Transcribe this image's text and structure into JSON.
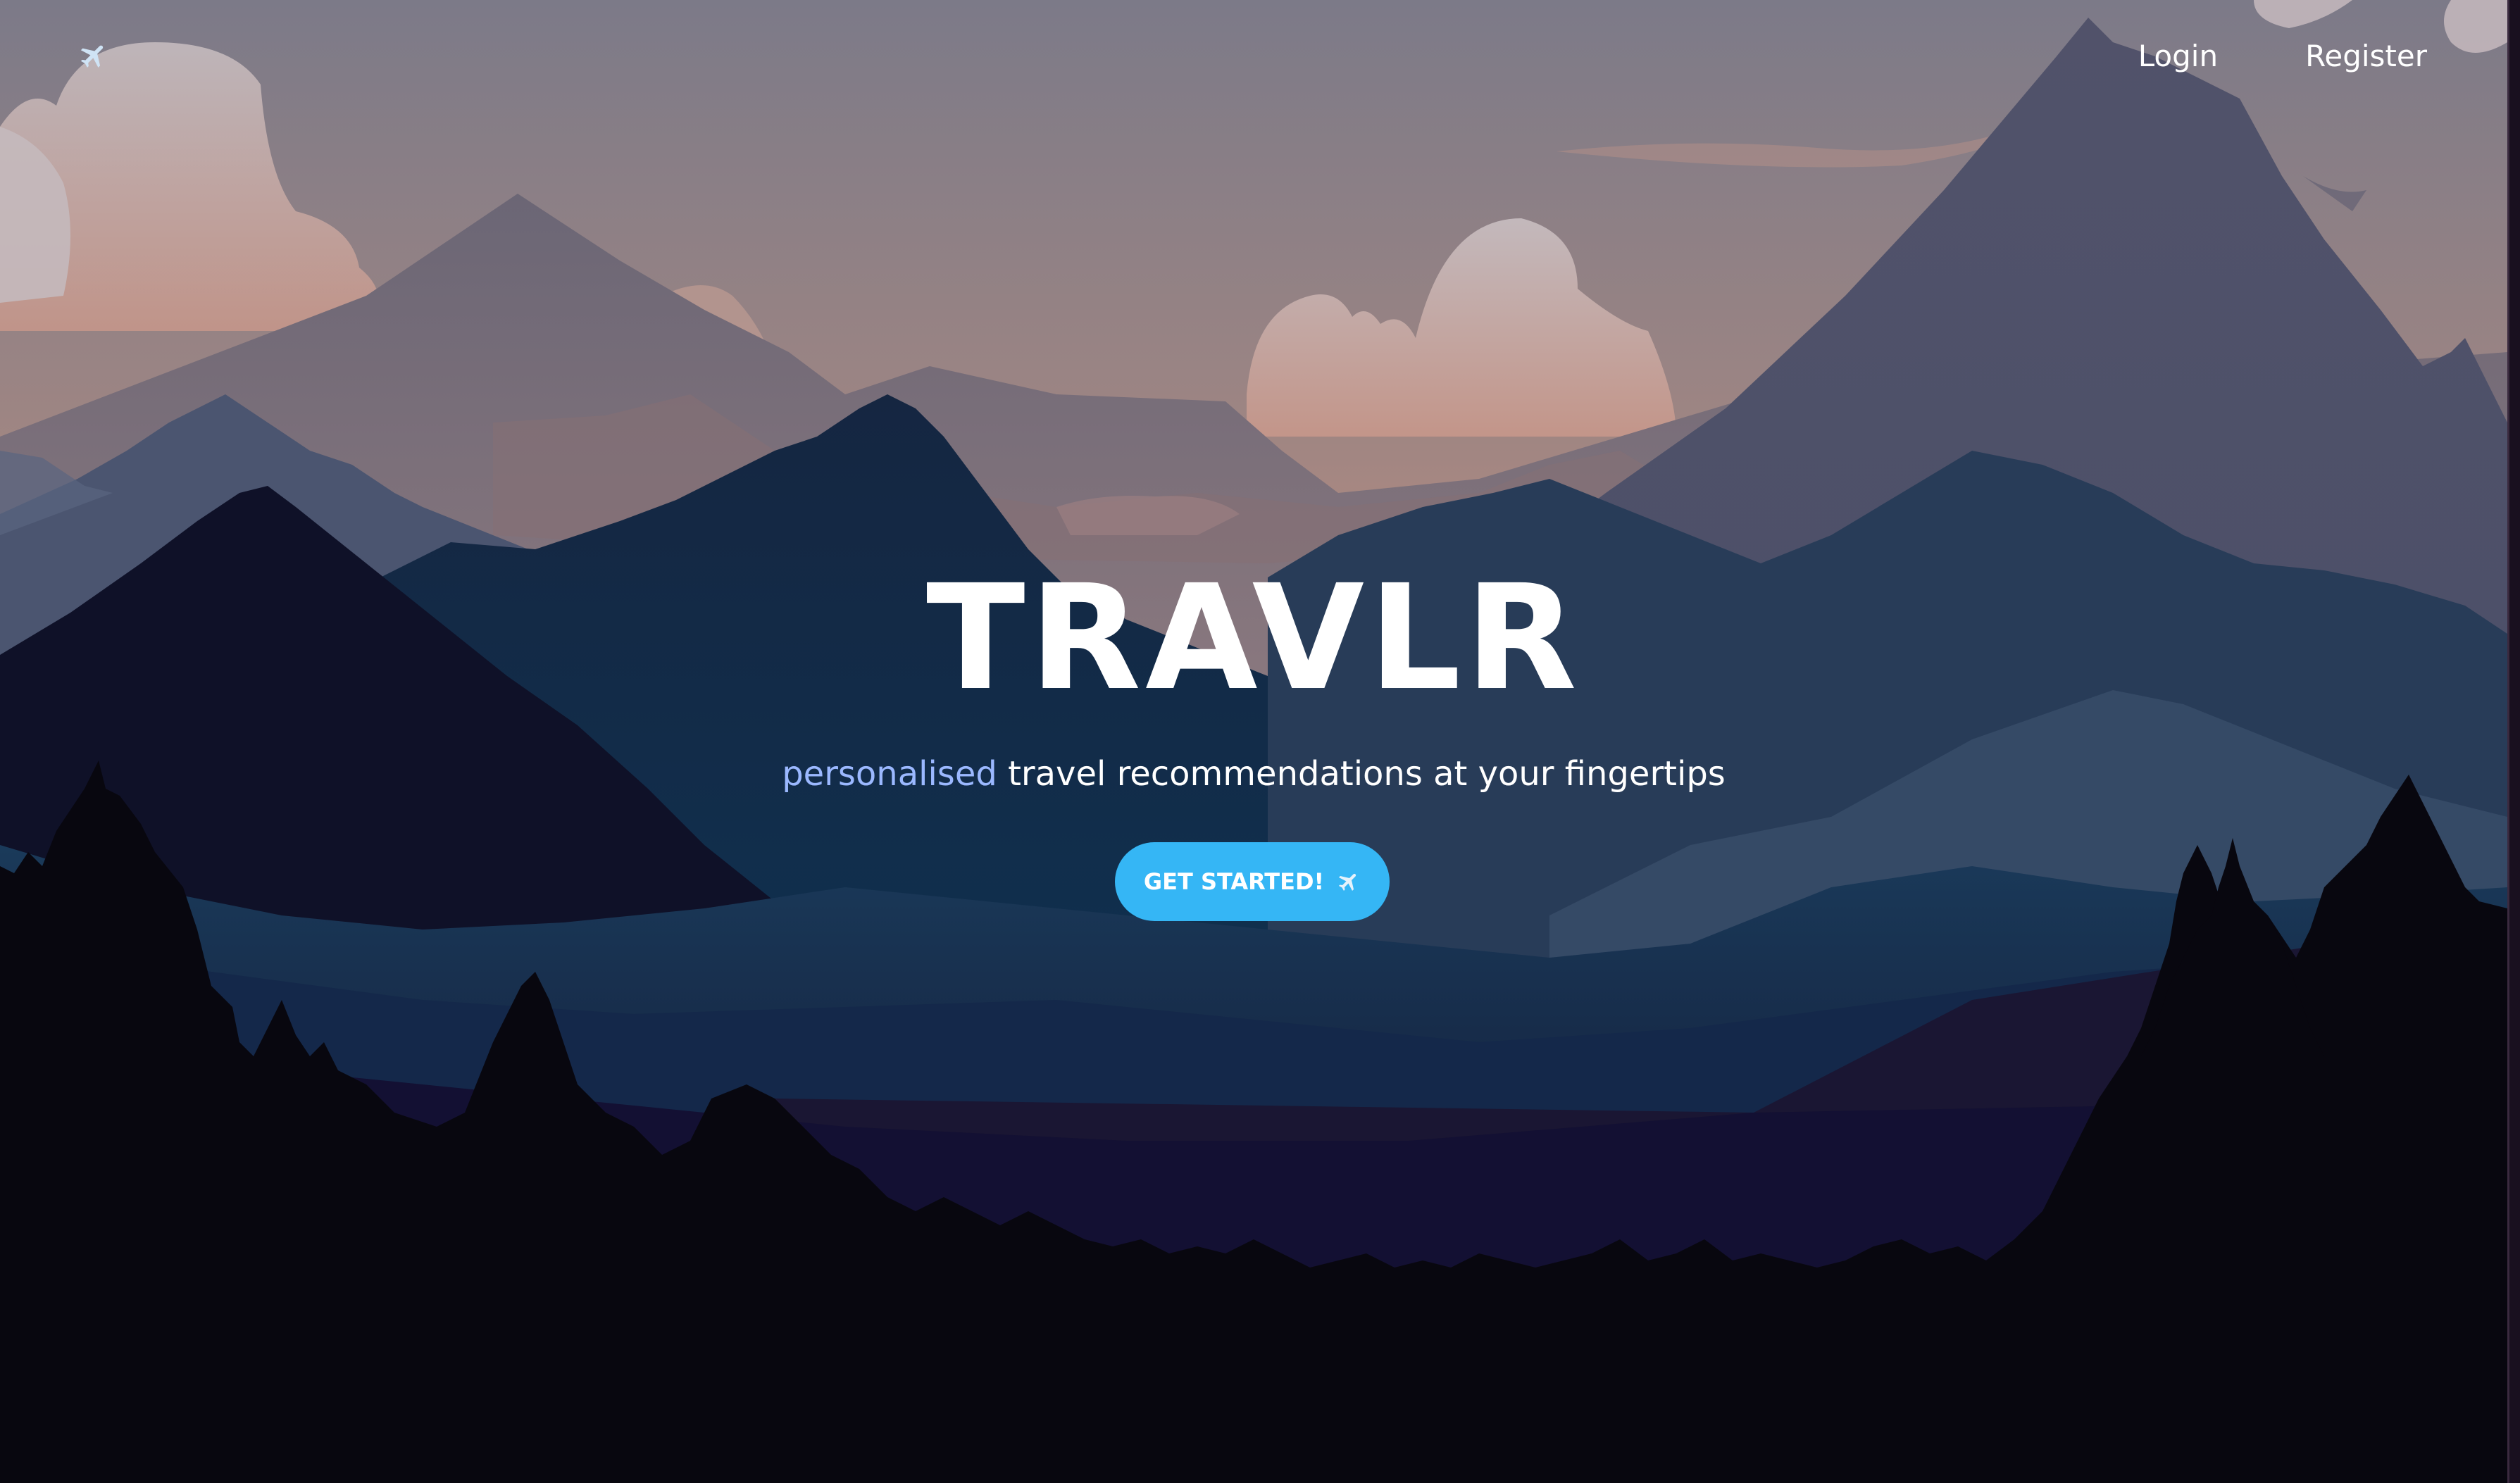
{
  "nav": {
    "logo_icon": "airplane-icon",
    "login_label": "Login",
    "register_label": "Register"
  },
  "hero": {
    "title": "TRAVLR",
    "subtitle_accent": "personalised",
    "subtitle_rest": " travel recommendations at your fingertips",
    "cta_label": "GET STARTED!",
    "cta_icon": "airplane-icon"
  },
  "colors": {
    "accent_text": "#9bb8ff",
    "cta_background": "#35b6f5",
    "sky_top": "#7c7a88",
    "sky_horizon": "#d0937a",
    "forest": "#07060d"
  }
}
